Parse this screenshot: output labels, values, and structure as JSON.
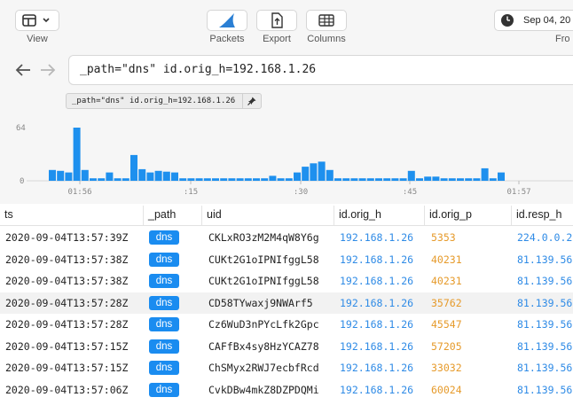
{
  "toolbar": {
    "view_label": "View",
    "packets_label": "Packets",
    "export_label": "Export",
    "columns_label": "Columns",
    "date_text": "Sep 04, 20",
    "from_label": "Fro"
  },
  "search": {
    "query": "_path=\"dns\" id.orig_h=192.168.1.26"
  },
  "pinned_filter": {
    "text": "_path=\"dns\" id.orig_h=192.168.1.26"
  },
  "histogram": {
    "y_max_label": "64",
    "y_min_label": "0",
    "x_ticks": [
      "01:56",
      ":15",
      ":30",
      ":45",
      "01:57"
    ],
    "bar_color": "#1e90ee"
  },
  "chart_data": {
    "type": "bar",
    "title": "",
    "xlabel": "",
    "ylabel": "",
    "ylim": [
      0,
      64
    ],
    "categories": [
      "01:56",
      ":15",
      ":30",
      ":45",
      "01:57"
    ],
    "values": [
      13,
      12,
      10,
      64,
      13,
      3,
      3,
      10,
      3,
      3,
      31,
      14,
      10,
      12,
      11,
      10,
      3,
      3,
      3,
      3,
      3,
      3,
      3,
      3,
      3,
      3,
      3,
      6,
      3,
      3,
      10,
      17,
      21,
      23,
      13,
      3,
      3,
      3,
      3,
      3,
      3,
      3,
      3,
      3,
      12,
      3,
      5,
      5,
      3,
      3,
      3,
      3,
      3,
      15,
      3,
      10
    ]
  },
  "table": {
    "columns": [
      "ts",
      "_path",
      "uid",
      "id.orig_h",
      "id.orig_p",
      "id.resp_h"
    ],
    "rows": [
      {
        "ts": "2020-09-04T13:57:39Z",
        "path": "dns",
        "uid": "CKLxRO3zM2M4qW8Y6g",
        "orig_h": "192.168.1.26",
        "orig_p": "5353",
        "resp_h": "224.0.0.2"
      },
      {
        "ts": "2020-09-04T13:57:38Z",
        "path": "dns",
        "uid": "CUKt2G1oIPNIfggL58",
        "orig_h": "192.168.1.26",
        "orig_p": "40231",
        "resp_h": "81.139.56"
      },
      {
        "ts": "2020-09-04T13:57:38Z",
        "path": "dns",
        "uid": "CUKt2G1oIPNIfggL58",
        "orig_h": "192.168.1.26",
        "orig_p": "40231",
        "resp_h": "81.139.56"
      },
      {
        "ts": "2020-09-04T13:57:28Z",
        "path": "dns",
        "uid": "CD58TYwaxj9NWArf5",
        "orig_h": "192.168.1.26",
        "orig_p": "35762",
        "resp_h": "81.139.56"
      },
      {
        "ts": "2020-09-04T13:57:28Z",
        "path": "dns",
        "uid": "Cz6WuD3nPYcLfk2Gpc",
        "orig_h": "192.168.1.26",
        "orig_p": "45547",
        "resp_h": "81.139.56"
      },
      {
        "ts": "2020-09-04T13:57:15Z",
        "path": "dns",
        "uid": "CAFfBx4sy8HzYCAZ78",
        "orig_h": "192.168.1.26",
        "orig_p": "57205",
        "resp_h": "81.139.56"
      },
      {
        "ts": "2020-09-04T13:57:15Z",
        "path": "dns",
        "uid": "ChSMyx2RWJ7ecbfRcd",
        "orig_h": "192.168.1.26",
        "orig_p": "33032",
        "resp_h": "81.139.56"
      },
      {
        "ts": "2020-09-04T13:57:06Z",
        "path": "dns",
        "uid": "CvkDBw4mkZ8DZPDQMi",
        "orig_h": "192.168.1.26",
        "orig_p": "60024",
        "resp_h": "81.139.56"
      }
    ]
  },
  "colors": {
    "badge": "#1a8cf0",
    "ip": "#2f8be6",
    "port": "#e69a2a",
    "accent": "#1e90ee"
  }
}
